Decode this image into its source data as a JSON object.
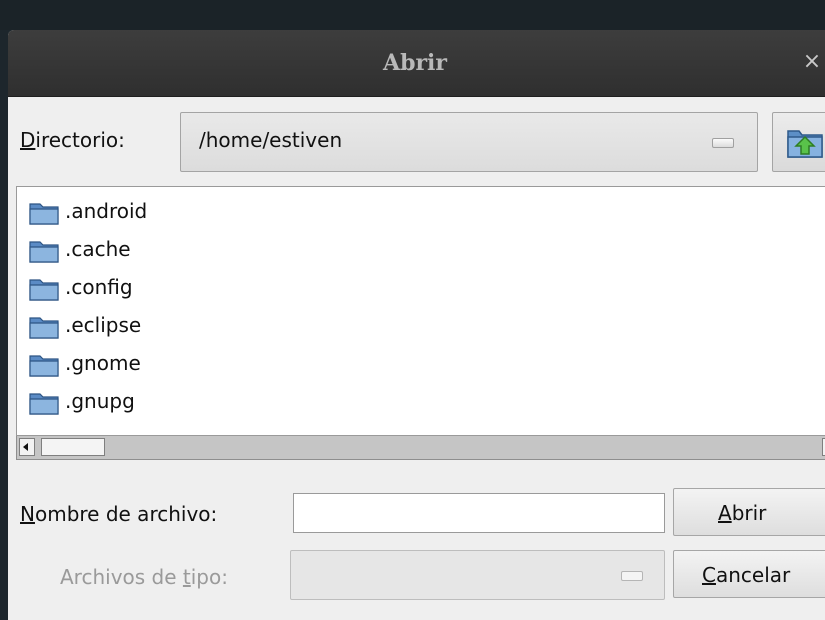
{
  "window": {
    "title": "Abrir",
    "close_symbol": "×"
  },
  "directory": {
    "label_mnemonic": "D",
    "label_rest": "irectorio:",
    "current": "/home/estiven",
    "up_icon": "folder-up-icon"
  },
  "files": [
    {
      "name": ".android",
      "icon": "folder-icon"
    },
    {
      "name": ".cache",
      "icon": "folder-icon"
    },
    {
      "name": ".config",
      "icon": "folder-icon"
    },
    {
      "name": ".eclipse",
      "icon": "folder-icon"
    },
    {
      "name": ".gnome",
      "icon": "folder-icon"
    },
    {
      "name": ".gnupg",
      "icon": "folder-icon"
    }
  ],
  "filename": {
    "label_mnemonic": "N",
    "label_rest": "ombre de archivo:",
    "value": ""
  },
  "filetype": {
    "label_before": "Archivos de ",
    "label_mnemonic": "t",
    "label_after": "ipo:",
    "value": ""
  },
  "buttons": {
    "open_mnemonic": "A",
    "open_rest": "brir",
    "cancel_mnemonic": "C",
    "cancel_rest": "ancelar"
  },
  "colors": {
    "titlebar": "#363636",
    "dialog_background": "#efefef",
    "folder_blue": "#5f8fc8"
  }
}
